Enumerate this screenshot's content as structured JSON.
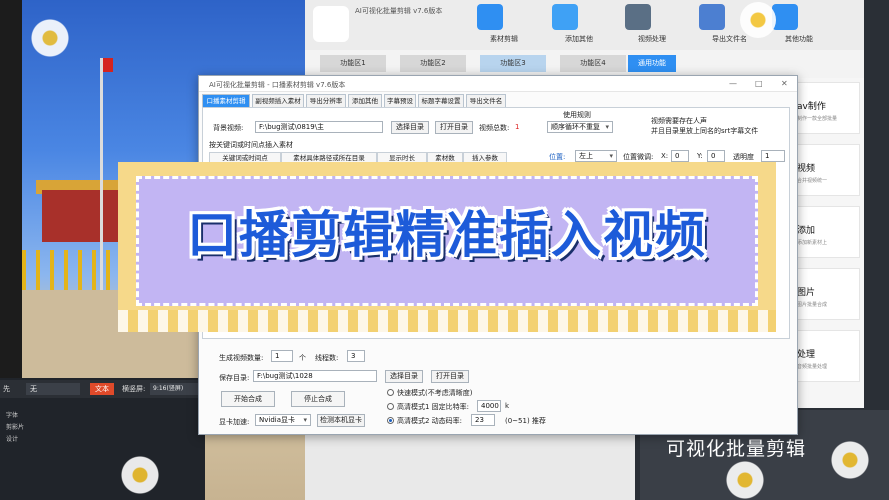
{
  "app": {
    "top_title": "AI可视化批量剪辑 v7.6版本",
    "top_nav": [
      {
        "label": "素材剪辑",
        "icon": "film-icon"
      },
      {
        "label": "添加其他",
        "icon": "add-layers-icon"
      },
      {
        "label": "视频处理",
        "icon": "sliders-icon"
      },
      {
        "label": "导出文件名",
        "icon": "export-icon"
      },
      {
        "label": "其他功能",
        "icon": "more-icon"
      }
    ],
    "function_tabs": [
      "功能区1",
      "功能区2",
      "功能区3",
      "功能区4",
      "通用功能"
    ],
    "right_cards": [
      {
        "title": "av制作",
        "sub": "制作一款全部批量"
      },
      {
        "title": "视频",
        "sub": "合并视频统一"
      },
      {
        "title": "添加",
        "sub": "添加新素材上"
      },
      {
        "title": "图片",
        "sub": "图片批量合成"
      },
      {
        "title": "处理",
        "sub": "音频批量处理"
      }
    ],
    "brand_text": "可视化批量剪辑",
    "bottom_left": {
      "prefix": "先",
      "selected": "无",
      "tag": "文本",
      "ratio_label": "横竖屏:",
      "ratio_value": "9:16(竖屏)",
      "side_items": [
        "字体",
        "剪影片",
        "设计"
      ]
    }
  },
  "dialog": {
    "title": "AI可视化批量剪辑 - 口播素材剪辑 v7.6版本",
    "window_controls": [
      "—",
      "□",
      "✕"
    ],
    "tabs": [
      "口播素材剪辑",
      "副视频插入素材",
      "导出分辨率",
      "添加其他",
      "字幕预设",
      "标题字幕设置",
      "导出文件名"
    ],
    "active_tab": 0,
    "bg_video_label": "背景视频:",
    "bg_video_path": "F:\\bug测试\\0819\\主",
    "select_dir_btn": "选择目录",
    "open_dir_btn": "打开目录",
    "video_total_label": "视频总数:",
    "video_total_value": "1",
    "use_rule_label": "使用规则",
    "use_rule_value": "顺序循环不重复",
    "note_line1": "视频需要存在人声",
    "note_line2": "并且目录里放上同名的srt字幕文件",
    "keyword_hint": "按关键词或时间点插入素材",
    "columns": [
      "关键词或时间点",
      "素材具体路径或所在目录",
      "显示时长",
      "素材数",
      "插入参数"
    ],
    "position_label": "位置:",
    "position_value": "左上",
    "offset_label": "位置微调:",
    "offset_x_label": "X:",
    "offset_x": "0",
    "offset_y_label": "Y:",
    "offset_y": "0",
    "opacity_label": "透明度",
    "opacity_value": "1",
    "gen_count_label": "生成视频数量:",
    "gen_count_value": "1",
    "gen_count_unit": "个",
    "threads_label": "线程数:",
    "threads_value": "3",
    "save_dir_label": "保存目录:",
    "save_dir_path": "F:\\bug测试\\1028",
    "save_select_btn": "选择目录",
    "save_open_btn": "打开目录",
    "start_btn": "开始合成",
    "stop_btn": "停止合成",
    "mode_fast": "快速模式(不考虑清晰度)",
    "mode_hq1": "高清模式1 固定比特率:",
    "mode_hq1_value": "4000",
    "mode_hq1_unit": "k",
    "mode_hq2": "高清模式2 动态码率:",
    "mode_hq2_value": "23",
    "mode_hq2_range": "(0~51) 推荐",
    "gpu_label": "显卡加速:",
    "gpu_value": "Nvidia显卡",
    "detect_gpu_btn": "检测本机显卡"
  },
  "overlay_banner": {
    "text": "口播剪辑精准插入视频"
  },
  "colors": {
    "accent_blue": "#2f8ff2",
    "banner_text": "#1d5bd9",
    "banner_fill": "#c2b5f3",
    "banner_border": "#f6d98a"
  }
}
